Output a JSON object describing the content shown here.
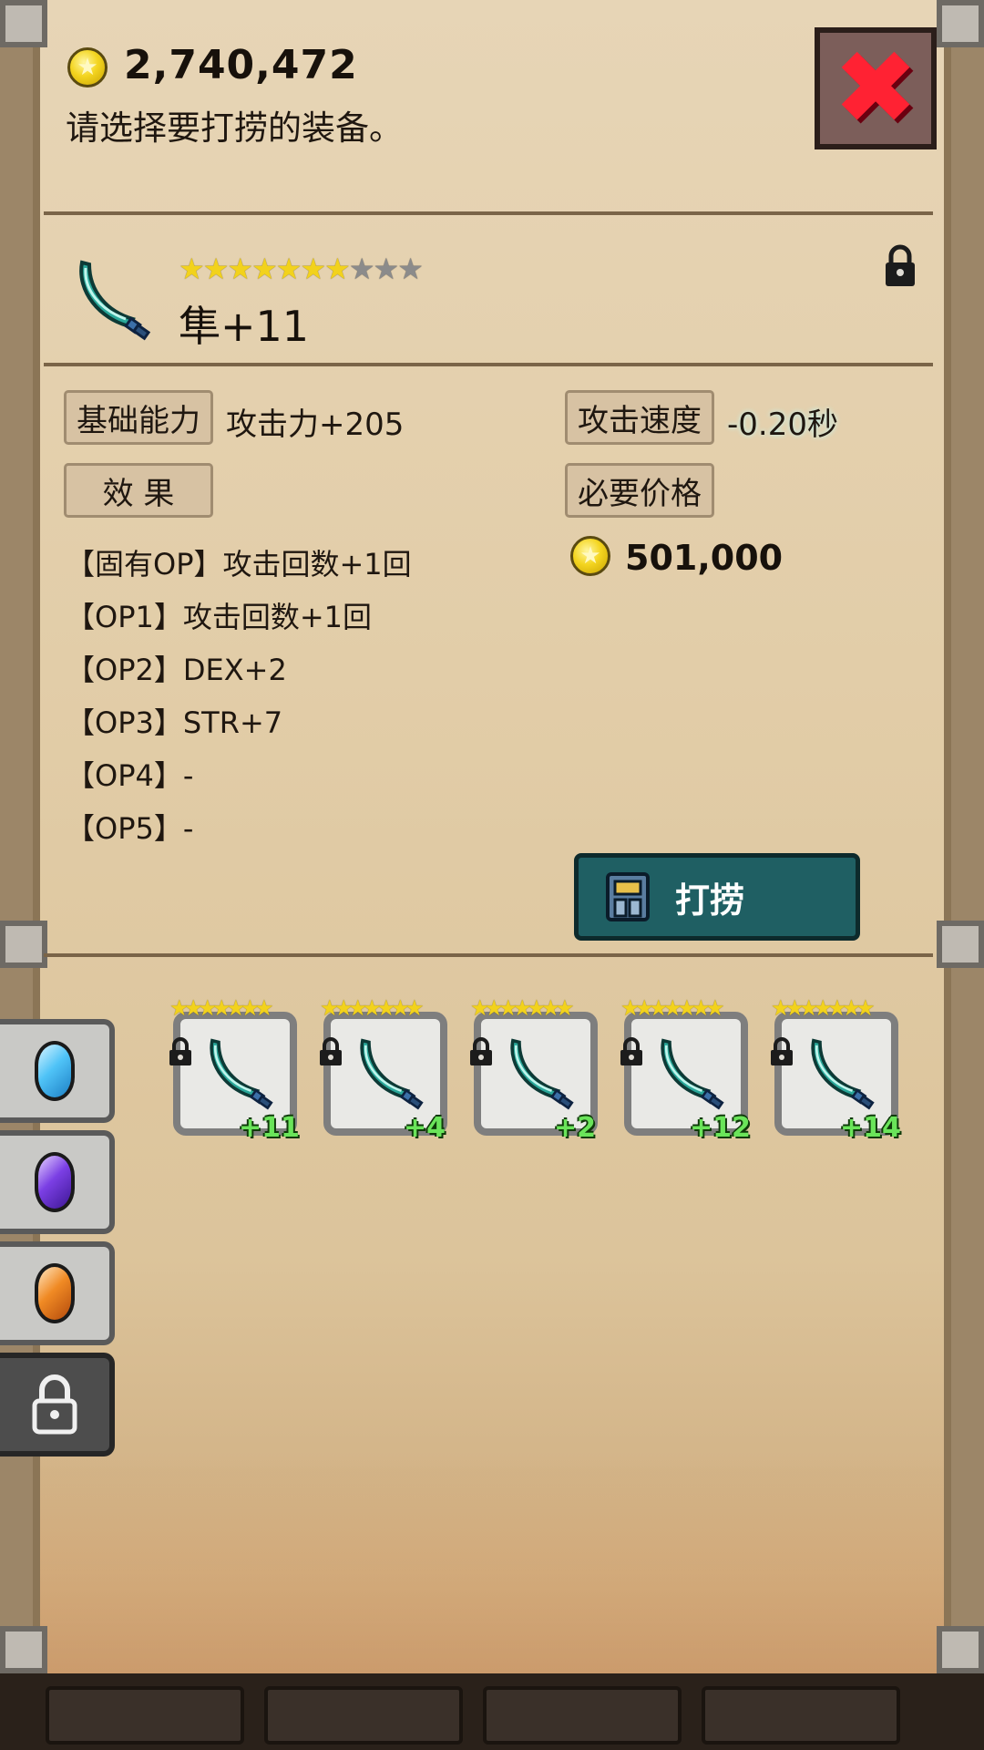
{
  "header": {
    "gold": "2,740,472",
    "prompt": "请选择要打捞的装备。"
  },
  "buttons": {
    "forge_label": "打捞"
  },
  "item": {
    "name": "隼+11",
    "stars_filled": 7,
    "stars_total": 10,
    "base_label": "基础能力",
    "base_value": "攻击力+205",
    "speed_label": "攻击速度",
    "speed_value": "-0.20秒",
    "effect_label": "效 果",
    "price_label": "必要价格",
    "price_value": "501,000",
    "options": [
      "【固有OP】攻击回数+1回",
      "【OP1】攻击回数+1回",
      "【OP2】DEX+2",
      "【OP3】STR+7",
      "【OP4】-",
      "【OP5】-"
    ]
  },
  "inventory": {
    "slots": [
      {
        "level": "+11"
      },
      {
        "level": "+4"
      },
      {
        "level": "+2"
      },
      {
        "level": "+12"
      },
      {
        "level": "+14"
      }
    ]
  },
  "colors": {
    "gem_blue": "#4fc3f7",
    "gem_purple": "#7b3fe4",
    "gem_orange": "#f08a24",
    "level_green": "#6ae45a"
  }
}
